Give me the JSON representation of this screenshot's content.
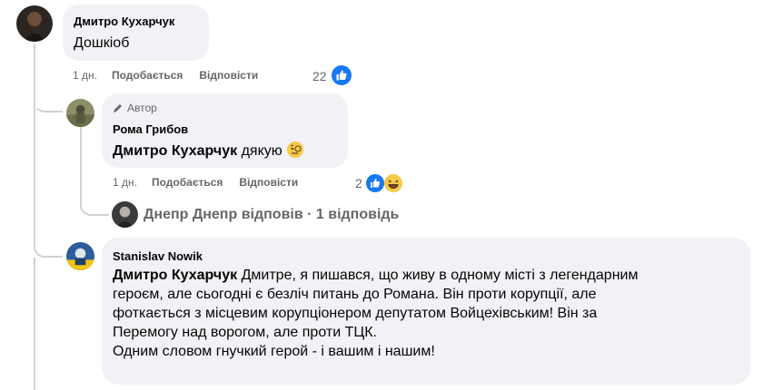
{
  "comment1": {
    "author": "Дмитро Кухарчук",
    "text": "Дошкіоб",
    "time": "1 дн.",
    "like_label": "Подобається",
    "reply_label": "Відповісти",
    "reaction_count": "22"
  },
  "reply1": {
    "badge": "Автор",
    "author": "Рома Грибов",
    "mention": "Дмитро Кухарчук",
    "text": "дякую",
    "time": "1 дн.",
    "like_label": "Подобається",
    "reply_label": "Відповісти",
    "reaction_count": "2"
  },
  "more_replies": {
    "label": "Днепр Днепр відповів · 1 відповідь"
  },
  "reply2": {
    "author": "Stanislav Nowik",
    "mention": "Дмитро Кухарчук",
    "line1": "Дмитре, я пишався, що живу в одному місті з легендарним",
    "line2": "героєм, але сьогодні є безліч питань до Романа. Він проти корупції, але",
    "line3": "фоткається з місцевим корупціонером депутатом Войцехівським! Він за",
    "line4": "Перемогу над ворогом, але проти ТЦК.",
    "line5": "Одним словом гнучкий герой - і вашим і нашим!"
  },
  "colors": {
    "like_blue": "#1877f2",
    "muted": "#65676b",
    "bubble": "#f0f2f5"
  }
}
